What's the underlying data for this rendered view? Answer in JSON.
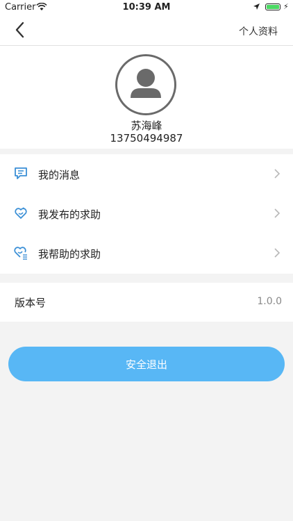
{
  "status_bar": {
    "carrier": "Carrier",
    "time": "10:39 AM"
  },
  "nav": {
    "title": "个人资料",
    "back_icon": "chevron-left-icon"
  },
  "profile": {
    "name": "苏海峰",
    "phone": "13750494987",
    "avatar_icon": "user-avatar-icon"
  },
  "menu": {
    "items": [
      {
        "label": "我的消息",
        "icon": "message-icon"
      },
      {
        "label": "我发布的求助",
        "icon": "heart-hand-icon"
      },
      {
        "label": "我帮助的求助",
        "icon": "heart-list-icon"
      }
    ]
  },
  "version": {
    "label": "版本号",
    "value": "1.0.0"
  },
  "logout": {
    "label": "安全退出"
  },
  "colors": {
    "accent": "#58b7f5",
    "icon_blue": "#3a8fd6",
    "background": "#f3f3f3"
  }
}
